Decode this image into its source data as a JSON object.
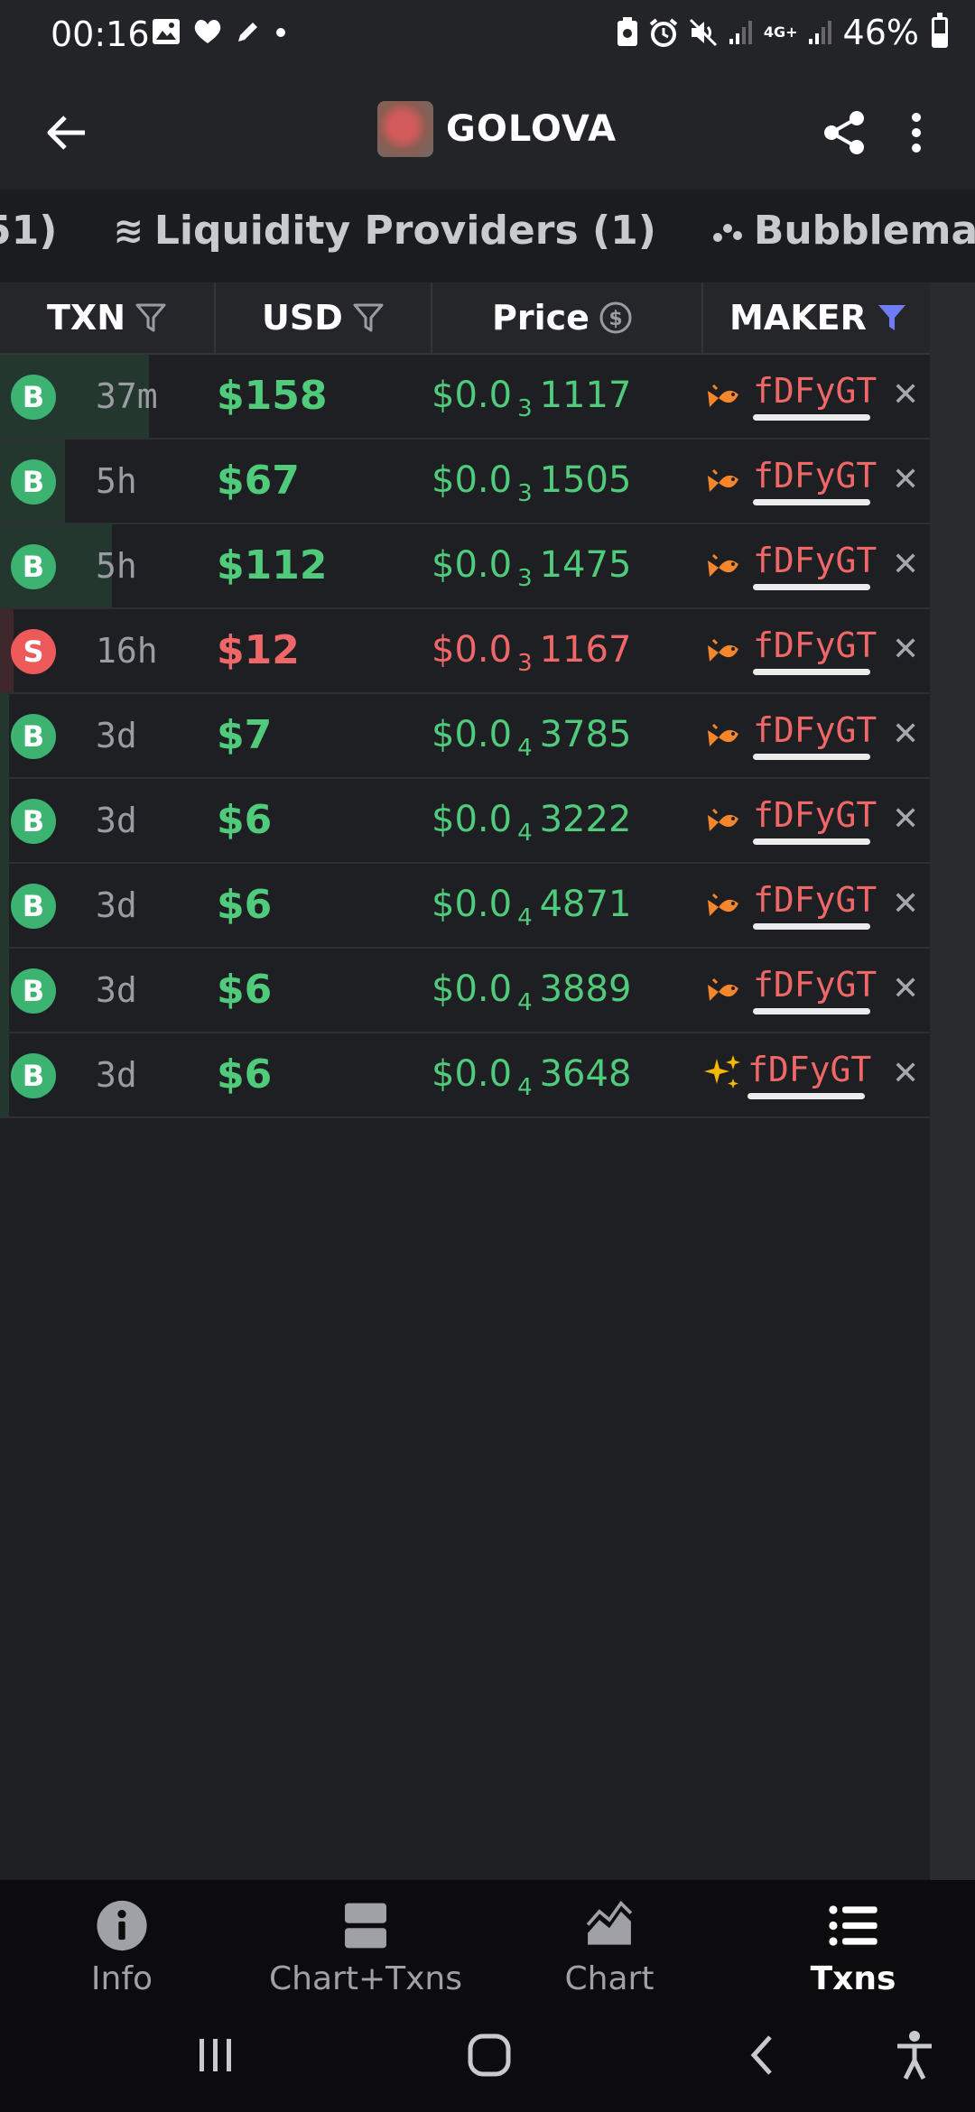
{
  "status_bar": {
    "time": "00:16",
    "battery": "46%",
    "battery_level": 0.46,
    "left_icons": [
      "image-icon",
      "heart-icon",
      "pencil-icon",
      "dot-icon"
    ],
    "right_icons": [
      "saver-icon",
      "alarm-icon",
      "mute-icon",
      "signal-icon",
      "4g-icon",
      "signal-icon",
      "battery-icon"
    ],
    "network_label": "4G+"
  },
  "app_bar": {
    "token_name": "GOLOVA"
  },
  "tabs": [
    {
      "label": "51)",
      "icon": ""
    },
    {
      "label": "Liquidity Providers (1)",
      "icon": "≋"
    },
    {
      "label": "Bubblemaps",
      "icon": "ıı"
    }
  ],
  "table": {
    "headers": {
      "txn": "TXN",
      "usd": "USD",
      "price": "Price",
      "maker": "MAKER"
    },
    "rows": [
      {
        "type": "B",
        "side": "buy",
        "age": "37m",
        "usd": "$158",
        "price_prefix": "$0.0",
        "price_zeros": "3",
        "price_digits": "1117",
        "maker": "fDFyGT",
        "maker_icon": "fish-icon",
        "volume_fraction": 0.16
      },
      {
        "type": "B",
        "side": "buy",
        "age": "5h",
        "usd": "$67",
        "price_prefix": "$0.0",
        "price_zeros": "3",
        "price_digits": "1505",
        "maker": "fDFyGT",
        "maker_icon": "fish-icon",
        "volume_fraction": 0.07
      },
      {
        "type": "B",
        "side": "buy",
        "age": "5h",
        "usd": "$112",
        "price_prefix": "$0.0",
        "price_zeros": "3",
        "price_digits": "1475",
        "maker": "fDFyGT",
        "maker_icon": "fish-icon",
        "volume_fraction": 0.12
      },
      {
        "type": "S",
        "side": "sell",
        "age": "16h",
        "usd": "$12",
        "price_prefix": "$0.0",
        "price_zeros": "3",
        "price_digits": "1167",
        "maker": "fDFyGT",
        "maker_icon": "fish-icon",
        "volume_fraction": 0.015
      },
      {
        "type": "B",
        "side": "buy",
        "age": "3d",
        "usd": "$7",
        "price_prefix": "$0.0",
        "price_zeros": "4",
        "price_digits": "3785",
        "maker": "fDFyGT",
        "maker_icon": "fish-icon",
        "volume_fraction": 0.01
      },
      {
        "type": "B",
        "side": "buy",
        "age": "3d",
        "usd": "$6",
        "price_prefix": "$0.0",
        "price_zeros": "4",
        "price_digits": "3222",
        "maker": "fDFyGT",
        "maker_icon": "fish-icon",
        "volume_fraction": 0.01
      },
      {
        "type": "B",
        "side": "buy",
        "age": "3d",
        "usd": "$6",
        "price_prefix": "$0.0",
        "price_zeros": "4",
        "price_digits": "4871",
        "maker": "fDFyGT",
        "maker_icon": "fish-icon",
        "volume_fraction": 0.01
      },
      {
        "type": "B",
        "side": "buy",
        "age": "3d",
        "usd": "$6",
        "price_prefix": "$0.0",
        "price_zeros": "4",
        "price_digits": "3889",
        "maker": "fDFyGT",
        "maker_icon": "fish-icon",
        "volume_fraction": 0.01
      },
      {
        "type": "B",
        "side": "buy",
        "age": "3d",
        "usd": "$6",
        "price_prefix": "$0.0",
        "price_zeros": "4",
        "price_digits": "3648",
        "maker": "fDFyGT",
        "maker_icon": "sparkles-icon",
        "volume_fraction": 0.01
      }
    ],
    "remove_glyph": "✕"
  },
  "bottom_nav": [
    {
      "label": "Info",
      "icon": "info-icon",
      "active": false
    },
    {
      "label": "Chart+Txns",
      "icon": "chart-txns-icon",
      "active": false
    },
    {
      "label": "Chart",
      "icon": "chart-icon",
      "active": false
    },
    {
      "label": "Txns",
      "icon": "list-icon",
      "active": true
    }
  ],
  "colors": {
    "buy": "#4fcb7b",
    "sell": "#f06767",
    "buy_badge": "#3cb371",
    "sell_badge": "#ee5a5a",
    "filter_active": "#6f7cf6",
    "background": "#1e1f23"
  }
}
